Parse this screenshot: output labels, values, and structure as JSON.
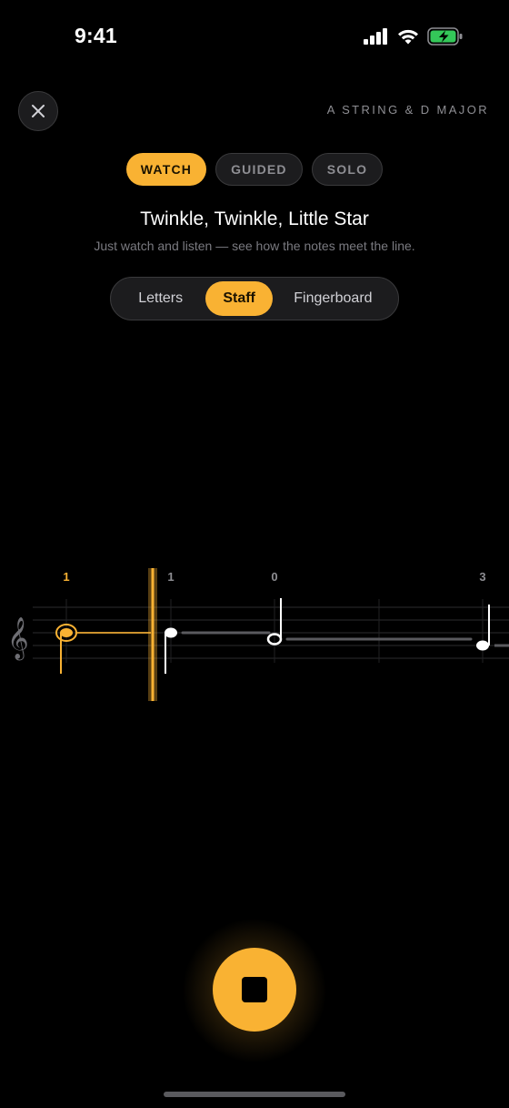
{
  "status_bar": {
    "time": "9:41",
    "icons": [
      "cellular-signal-icon",
      "wifi-icon",
      "battery-charging-icon"
    ]
  },
  "header": {
    "close_icon": "close-icon",
    "caption": "A STRING & D MAJOR"
  },
  "mode_tabs": [
    {
      "label": "WATCH",
      "active": true
    },
    {
      "label": "GUIDED",
      "active": false
    },
    {
      "label": "SOLO",
      "active": false
    }
  ],
  "song": {
    "title": "Twinkle, Twinkle, Little Star",
    "subtitle": "Just watch and listen — see how the notes meet the line."
  },
  "view_toggle": {
    "options": [
      "Letters",
      "Staff",
      "Fingerboard"
    ],
    "selected": "Staff"
  },
  "staff": {
    "clef": "𝄞",
    "finger_numbers": [
      "1",
      "1",
      "0",
      "3"
    ],
    "active_index": 0
  },
  "controls": {
    "stop_icon": "stop-icon"
  },
  "colors": {
    "accent": "#f9b233",
    "background": "#000000",
    "surface": "#1c1c1e",
    "muted_text": "#8e8e93"
  }
}
